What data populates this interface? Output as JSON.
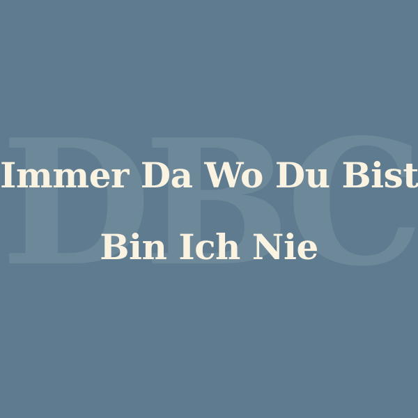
{
  "watermark": {
    "text": "DBC"
  },
  "title": {
    "line1": "Immer Da Wo Du Bist",
    "line2": "Bin Ich Nie"
  },
  "colors": {
    "background": "#5e7b8f",
    "watermark": "#6d8899",
    "title_text": "#fbf3e1"
  }
}
